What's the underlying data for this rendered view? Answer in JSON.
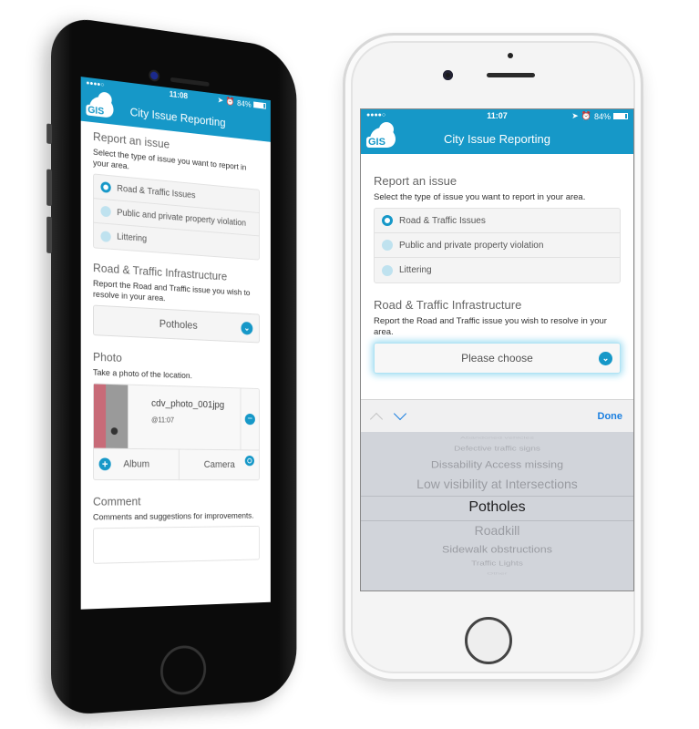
{
  "app": {
    "title": "City Issue Reporting",
    "logo_text": "GIS",
    "brand_color": "#1698c8"
  },
  "phones": [
    {
      "id": "left",
      "status": {
        "signal": "●●●●○",
        "time": "11:08",
        "location_icon": "location-arrow-icon",
        "alarm_icon": "alarm-icon",
        "battery": "84%",
        "battery_level": 0.84
      },
      "report": {
        "title": "Report an issue",
        "description": "Select the type of issue you want to report in your area.",
        "options": [
          {
            "label": "Road & Traffic Issues",
            "selected": true
          },
          {
            "label": "Public and private property violation",
            "selected": false
          },
          {
            "label": "Littering",
            "selected": false
          }
        ]
      },
      "infrastructure": {
        "title": "Road & Traffic Infrastructure",
        "description": "Report the Road and Traffic issue you wish to resolve in your area.",
        "selected_value": "Potholes"
      },
      "photo": {
        "title": "Photo",
        "description": "Take a photo of the location.",
        "filename": "cdv_photo_001jpg",
        "timestamp": "@11:07",
        "album_label": "Album",
        "camera_label": "Camera"
      },
      "comment": {
        "title": "Comment",
        "description": "Comments and suggestions for improvements.",
        "value": ""
      }
    },
    {
      "id": "right",
      "status": {
        "signal": "●●●●○",
        "time": "11:07",
        "location_icon": "location-arrow-icon",
        "alarm_icon": "alarm-icon",
        "battery": "84%",
        "battery_level": 0.84
      },
      "report": {
        "title": "Report an issue",
        "description": "Select the type of issue you want to report in your area.",
        "options": [
          {
            "label": "Road & Traffic Issues",
            "selected": true
          },
          {
            "label": "Public and private property violation",
            "selected": false
          },
          {
            "label": "Littering",
            "selected": false
          }
        ]
      },
      "infrastructure": {
        "title": "Road & Traffic Infrastructure",
        "description": "Report the Road and Traffic issue you wish to resolve in your area.",
        "placeholder": "Please choose"
      },
      "picker_toolbar": {
        "done_label": "Done"
      },
      "picker": {
        "items": [
          "Abandoned vehicles",
          "Defective traffic signs",
          "Dissability Access missing",
          "Low visibility at Intersections",
          "Potholes",
          "Roadkill",
          "Sidewalk obstructions",
          "Traffic Lights",
          "Other"
        ],
        "selected_index": 4
      }
    }
  ]
}
